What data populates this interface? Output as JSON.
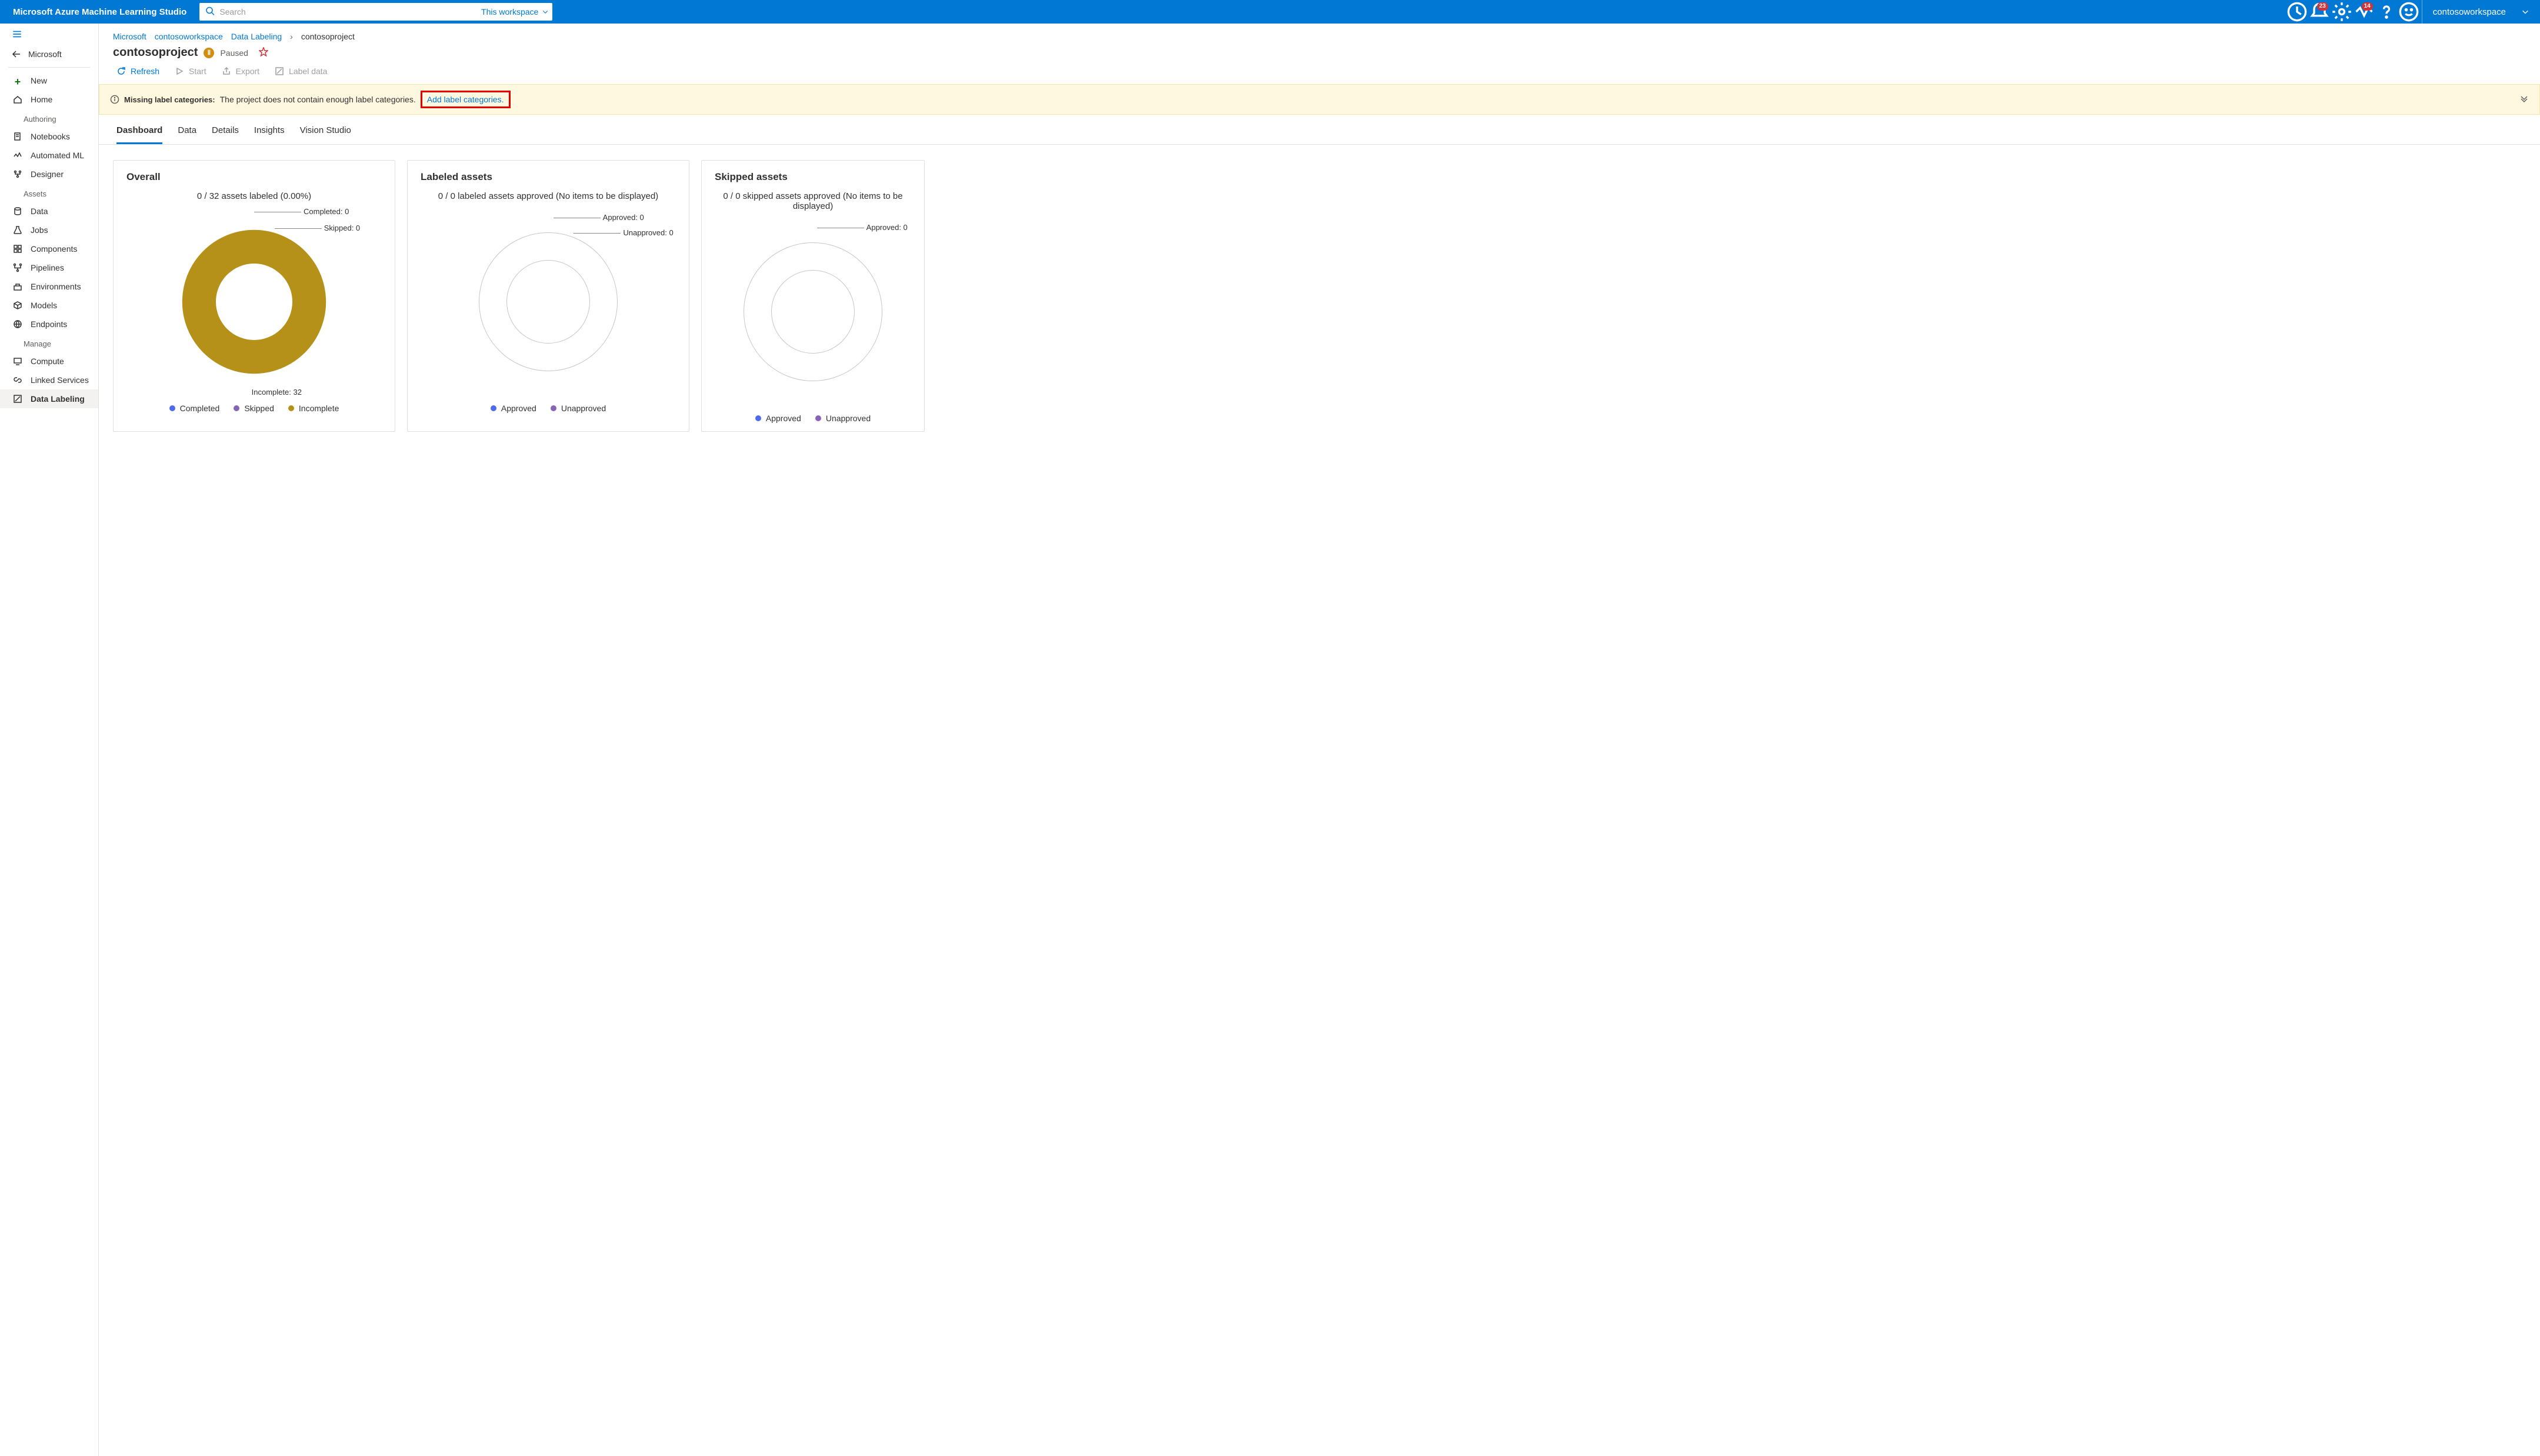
{
  "brand": "Microsoft Azure Machine Learning Studio",
  "search": {
    "placeholder": "Search",
    "scope": "This workspace"
  },
  "workspaceName": "contosoworkspace",
  "badges": {
    "notifications": "23",
    "diagnostics": "14"
  },
  "sidebar": {
    "back": "Microsoft",
    "new": "New",
    "home": "Home",
    "section_authoring": "Authoring",
    "notebooks": "Notebooks",
    "automl": "Automated ML",
    "designer": "Designer",
    "section_assets": "Assets",
    "data": "Data",
    "jobs": "Jobs",
    "components": "Components",
    "pipelines": "Pipelines",
    "environments": "Environments",
    "models": "Models",
    "endpoints": "Endpoints",
    "section_manage": "Manage",
    "compute": "Compute",
    "linked": "Linked Services",
    "labeling": "Data Labeling"
  },
  "breadcrumbs": {
    "root": "Microsoft",
    "ws": "contosoworkspace",
    "area": "Data Labeling",
    "project": "contosoproject"
  },
  "project": {
    "name": "contosoproject",
    "status": "Paused"
  },
  "actions": {
    "refresh": "Refresh",
    "start": "Start",
    "export": "Export",
    "label": "Label data"
  },
  "alert": {
    "label": "Missing label categories:",
    "text": "The project does not contain enough label categories.",
    "link": "Add label categories."
  },
  "tabs": [
    "Dashboard",
    "Data",
    "Details",
    "Insights",
    "Vision Studio"
  ],
  "cards": {
    "overall": {
      "title": "Overall",
      "subtitle": "0 / 32 assets labeled (0.00%)",
      "callouts": {
        "completed": "Completed: 0",
        "skipped": "Skipped: 0",
        "incomplete": "Incomplete: 32"
      },
      "legend": [
        "Completed",
        "Skipped",
        "Incomplete"
      ]
    },
    "labeled": {
      "title": "Labeled assets",
      "subtitle": "0 / 0 labeled assets approved (No items to be displayed)",
      "callouts": {
        "approved": "Approved: 0",
        "unapproved": "Unapproved: 0"
      },
      "legend": [
        "Approved",
        "Unapproved"
      ]
    },
    "skipped": {
      "title": "Skipped assets",
      "subtitle": "0 / 0 skipped assets approved (No items to be displayed)",
      "callouts": {
        "approved": "Approved: 0"
      },
      "legend": [
        "Approved",
        "Unapproved"
      ]
    }
  },
  "colors": {
    "completed": "#4f6bed",
    "skipped": "#8764b8",
    "incomplete": "#b69119",
    "approved": "#4f6bed",
    "unapproved": "#8764b8"
  },
  "chart_data": [
    {
      "type": "pie",
      "title": "Overall — 0 / 32 assets labeled (0.00%)",
      "categories": [
        "Completed",
        "Skipped",
        "Incomplete"
      ],
      "values": [
        0,
        0,
        32
      ],
      "series": [
        {
          "name": "Completed",
          "value": 0,
          "color": "#4f6bed"
        },
        {
          "name": "Skipped",
          "value": 0,
          "color": "#8764b8"
        },
        {
          "name": "Incomplete",
          "value": 32,
          "color": "#b69119"
        }
      ]
    },
    {
      "type": "pie",
      "title": "Labeled assets — 0 / 0 labeled assets approved",
      "categories": [
        "Approved",
        "Unapproved"
      ],
      "values": [
        0,
        0
      ],
      "series": [
        {
          "name": "Approved",
          "value": 0,
          "color": "#4f6bed"
        },
        {
          "name": "Unapproved",
          "value": 0,
          "color": "#8764b8"
        }
      ]
    },
    {
      "type": "pie",
      "title": "Skipped assets — 0 / 0 skipped assets approved",
      "categories": [
        "Approved",
        "Unapproved"
      ],
      "values": [
        0,
        0
      ],
      "series": [
        {
          "name": "Approved",
          "value": 0,
          "color": "#4f6bed"
        },
        {
          "name": "Unapproved",
          "value": 0,
          "color": "#8764b8"
        }
      ]
    }
  ]
}
